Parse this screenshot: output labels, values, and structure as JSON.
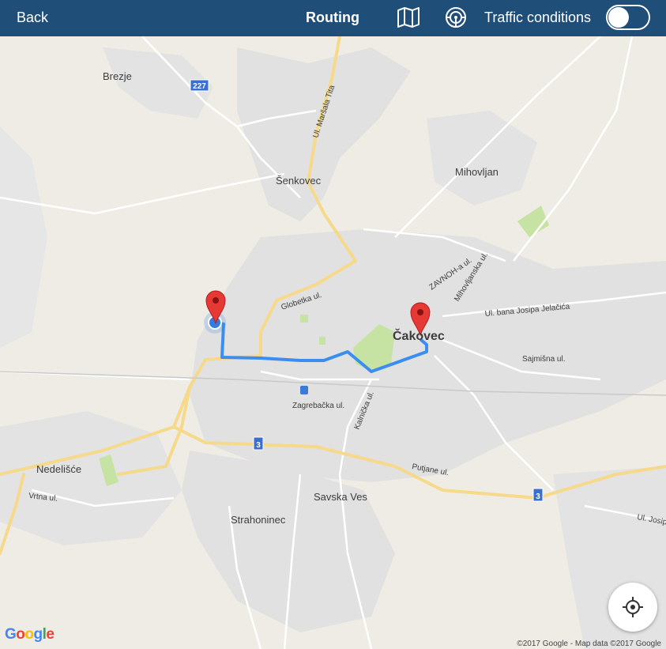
{
  "header": {
    "back_label": "Back",
    "title": "Routing",
    "map_icon": "map-icon",
    "steering_icon": "steering-wheel-icon",
    "traffic_label": "Traffic conditions",
    "traffic_toggle_on": false
  },
  "map": {
    "places": {
      "brezje": "Brezje",
      "senkovec": "Šenkovec",
      "mihovljan": "Mihovljan",
      "cakovec": "Čakovec",
      "nedelisce": "Nedelišće",
      "savska_ves": "Savska Ves",
      "strahoninec": "Strahoninec"
    },
    "streets": {
      "marsala_tita": "Ul. Maršala Tita",
      "globetka": "Globetka ul.",
      "zavnoh": "ZAVNOH-a ul.",
      "mihovljanska": "Mihovljanska ul.",
      "bana_jelacica": "Ul. bana Josipa Jelačića",
      "sajmisna": "Sajmišna ul.",
      "zagrebacka": "Zagrebačka ul.",
      "kalnicka": "Kalnička ul.",
      "putjane": "Putjane ul.",
      "vrtna": "Vrtna ul.",
      "josipa": "Ul. Josip"
    },
    "road_shields": {
      "r227": "227",
      "r3a": "3",
      "r3b": "3"
    },
    "colors": {
      "route": "#3b8ef0",
      "marker": "#e53935",
      "current_location": "#2f7de1",
      "highway": "#f6dc8f",
      "urban": "#e1e1e1",
      "park": "#c7e3a4"
    }
  },
  "controls": {
    "locate_icon": "crosshair-icon"
  },
  "footer": {
    "google_logo": "Google",
    "copyright": "©2017 Google - Map data ©2017 Google"
  }
}
